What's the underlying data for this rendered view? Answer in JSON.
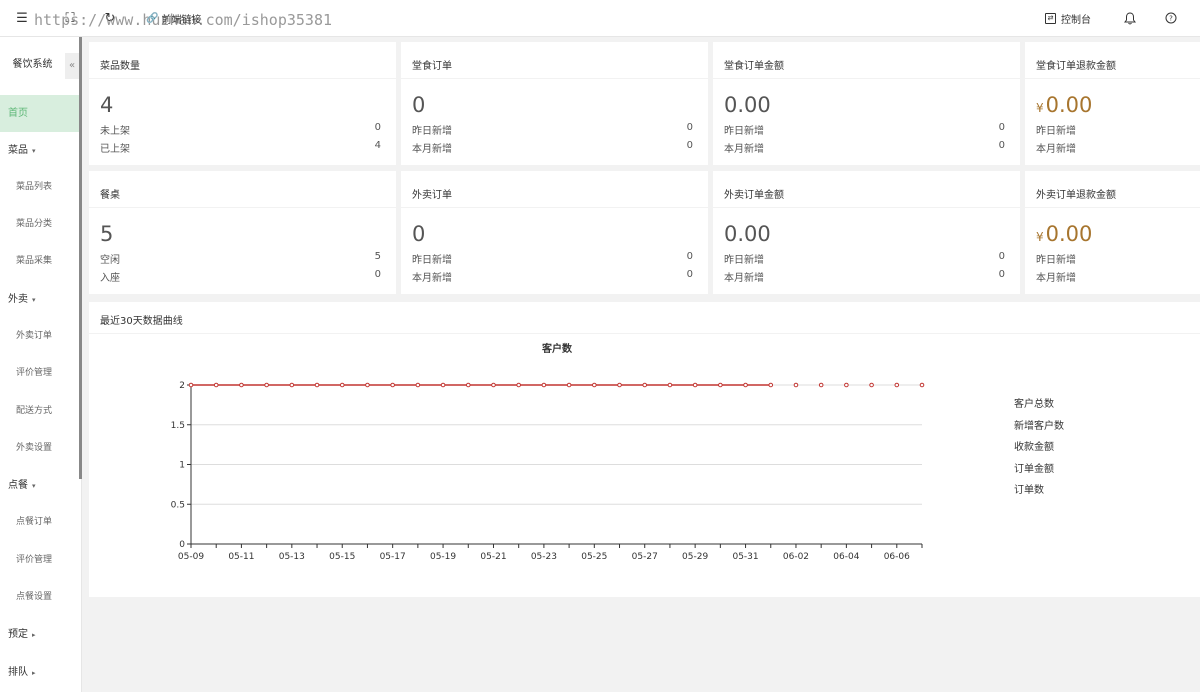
{
  "topbar": {
    "menu_icon": "menu-icon",
    "watermark": "https://www.huzhan.com/ishop35381",
    "front_link_label": "前端链接",
    "console_label": "控制台"
  },
  "sidebar": {
    "brand": "餐饮系统",
    "collapse": "«",
    "items": [
      {
        "label": "首页"
      },
      {
        "label": "菜品"
      },
      {
        "label": "菜品列表"
      },
      {
        "label": "菜品分类"
      },
      {
        "label": "菜品采集"
      },
      {
        "label": "外卖"
      },
      {
        "label": "外卖订单"
      },
      {
        "label": "评价管理"
      },
      {
        "label": "配送方式"
      },
      {
        "label": "外卖设置"
      },
      {
        "label": "点餐"
      },
      {
        "label": "点餐订单"
      },
      {
        "label": "评价管理"
      },
      {
        "label": "点餐设置"
      },
      {
        "label": "预定"
      },
      {
        "label": "排队"
      }
    ]
  },
  "cards": [
    {
      "title": "菜品数量",
      "value": "4",
      "rows": [
        {
          "label": "未上架",
          "num": "0"
        },
        {
          "label": "已上架",
          "num": "4"
        }
      ]
    },
    {
      "title": "堂食订单",
      "value": "0",
      "rows": [
        {
          "label": "昨日新增",
          "num": "0"
        },
        {
          "label": "本月新增",
          "num": "0"
        }
      ]
    },
    {
      "title": "堂食订单金额",
      "value": "0.00",
      "rows": [
        {
          "label": "昨日新增",
          "num": "0"
        },
        {
          "label": "本月新增",
          "num": "0"
        }
      ]
    },
    {
      "title": "堂食订单退款金额",
      "currency": "¥",
      "value": "0.00",
      "rows": [
        {
          "label": "昨日新增",
          "num": ""
        },
        {
          "label": "本月新增",
          "num": ""
        }
      ]
    },
    {
      "title": "餐桌",
      "value": "5",
      "rows": [
        {
          "label": "空闲",
          "num": "5"
        },
        {
          "label": "入座",
          "num": "0"
        }
      ]
    },
    {
      "title": "外卖订单",
      "value": "0",
      "rows": [
        {
          "label": "昨日新增",
          "num": "0"
        },
        {
          "label": "本月新增",
          "num": "0"
        }
      ]
    },
    {
      "title": "外卖订单金额",
      "value": "0.00",
      "rows": [
        {
          "label": "昨日新增",
          "num": "0"
        },
        {
          "label": "本月新增",
          "num": "0"
        }
      ]
    },
    {
      "title": "外卖订单退款金额",
      "currency": "¥",
      "value": "0.00",
      "rows": [
        {
          "label": "昨日新增",
          "num": ""
        },
        {
          "label": "本月新增",
          "num": ""
        }
      ]
    }
  ],
  "chart_panel": {
    "title": "最近30天数据曲线"
  },
  "chart_data": {
    "type": "line",
    "title": "客户数",
    "xlabel": "",
    "ylabel": "",
    "ylim": [
      0,
      2
    ],
    "yticks": [
      "0",
      "0.5",
      "1",
      "1.5",
      "2"
    ],
    "x": [
      "05-09",
      "05-10",
      "05-11",
      "05-12",
      "05-13",
      "05-14",
      "05-15",
      "05-16",
      "05-17",
      "05-18",
      "05-19",
      "05-20",
      "05-21",
      "05-22",
      "05-23",
      "05-24",
      "05-25",
      "05-26",
      "05-27",
      "05-28",
      "05-29",
      "05-30",
      "05-31",
      "06-01",
      "06-02",
      "06-03",
      "06-04",
      "06-05",
      "06-06",
      "06-07"
    ],
    "xtick_labels": [
      "05-09",
      "05-11",
      "05-13",
      "05-15",
      "05-17",
      "05-19",
      "05-21",
      "05-23",
      "05-25",
      "05-27",
      "05-29",
      "05-31",
      "06-02",
      "06-04",
      "06-06"
    ],
    "legend": [
      "客户总数",
      "新增客户数",
      "收款金额",
      "订单金额",
      "订单数"
    ],
    "legend_position": "right",
    "grid": true,
    "series": [
      {
        "name": "客户总数",
        "color": "#c23531",
        "values": [
          2,
          2,
          2,
          2,
          2,
          2,
          2,
          2,
          2,
          2,
          2,
          2,
          2,
          2,
          2,
          2,
          2,
          2,
          2,
          2,
          2,
          2,
          2,
          2,
          2,
          2,
          2,
          2,
          2,
          2
        ]
      }
    ]
  }
}
